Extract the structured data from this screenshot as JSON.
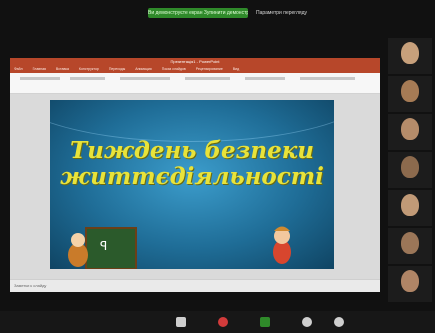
{
  "zoom": {
    "sharing_text": "Ви демонструєте екран  Зупинити демонстрацію",
    "view_options": "Параметри перегляду"
  },
  "powerpoint": {
    "title_bar": "Презентація1 - PowerPoint",
    "tabs": [
      "Файл",
      "Главная",
      "Вставка",
      "Конструктор",
      "Переходы",
      "Анимация",
      "Показ слайдов",
      "Рецензирование",
      "Вид"
    ],
    "notes_hint": "Заметки к слайду"
  },
  "slide": {
    "title_line1": "Тиждень безпеки",
    "title_line2": "життєдіяльності"
  },
  "accent_colors": {
    "zoom_green": "#2f8a2a",
    "ppt_red": "#b7472a",
    "slide_blue": "#1f6d97",
    "title_yellow": "#e8e33a"
  }
}
